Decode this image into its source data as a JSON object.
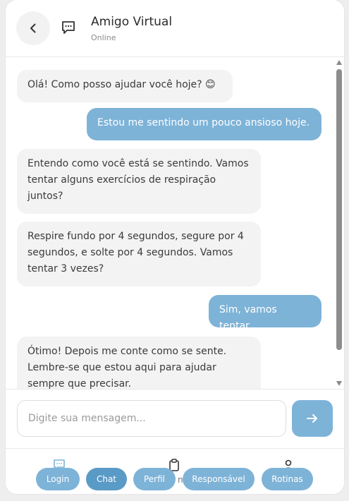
{
  "header": {
    "title": "Amigo Virtual",
    "status": "Online"
  },
  "messages": [
    {
      "sender": "bot",
      "text": "Olá! Como posso ajudar você hoje? 😊"
    },
    {
      "sender": "user",
      "text": "Estou me sentindo um pouco ansioso hoje."
    },
    {
      "sender": "bot",
      "text": "Entendo como você está se sentindo. Vamos tentar alguns exercícios de respiração juntos?"
    },
    {
      "sender": "bot",
      "text": "Respire fundo por 4 segundos, segure por 4 segundos, e solte por 4 segundos. Vamos tentar 3 vezes?"
    },
    {
      "sender": "user",
      "text": "Sim, vamos tentar."
    },
    {
      "sender": "bot",
      "text": "Ótimo! Depois me conte como se sente. Lembre-se que estou aqui para ajudar sempre que precisar."
    }
  ],
  "input": {
    "placeholder": "Digite sua mensagem..."
  },
  "nav": {
    "partial_text": "nc",
    "buttons": [
      {
        "label": "Login",
        "active": false
      },
      {
        "label": "Chat",
        "active": true
      },
      {
        "label": "Perfil",
        "active": false
      },
      {
        "label": "Responsável",
        "active": false
      },
      {
        "label": "Rotinas",
        "active": false
      }
    ]
  },
  "colors": {
    "accent": "#7eb3d8",
    "accent_active": "#5a9ac6",
    "bot_bubble": "#f3f3f3"
  },
  "icons": {
    "back": "chevron-left-icon",
    "chat": "chat-bubble-icon",
    "send": "arrow-right-icon",
    "nav_chat": "chat-bubble-icon",
    "nav_clipboard": "clipboard-icon",
    "nav_user": "user-icon"
  }
}
